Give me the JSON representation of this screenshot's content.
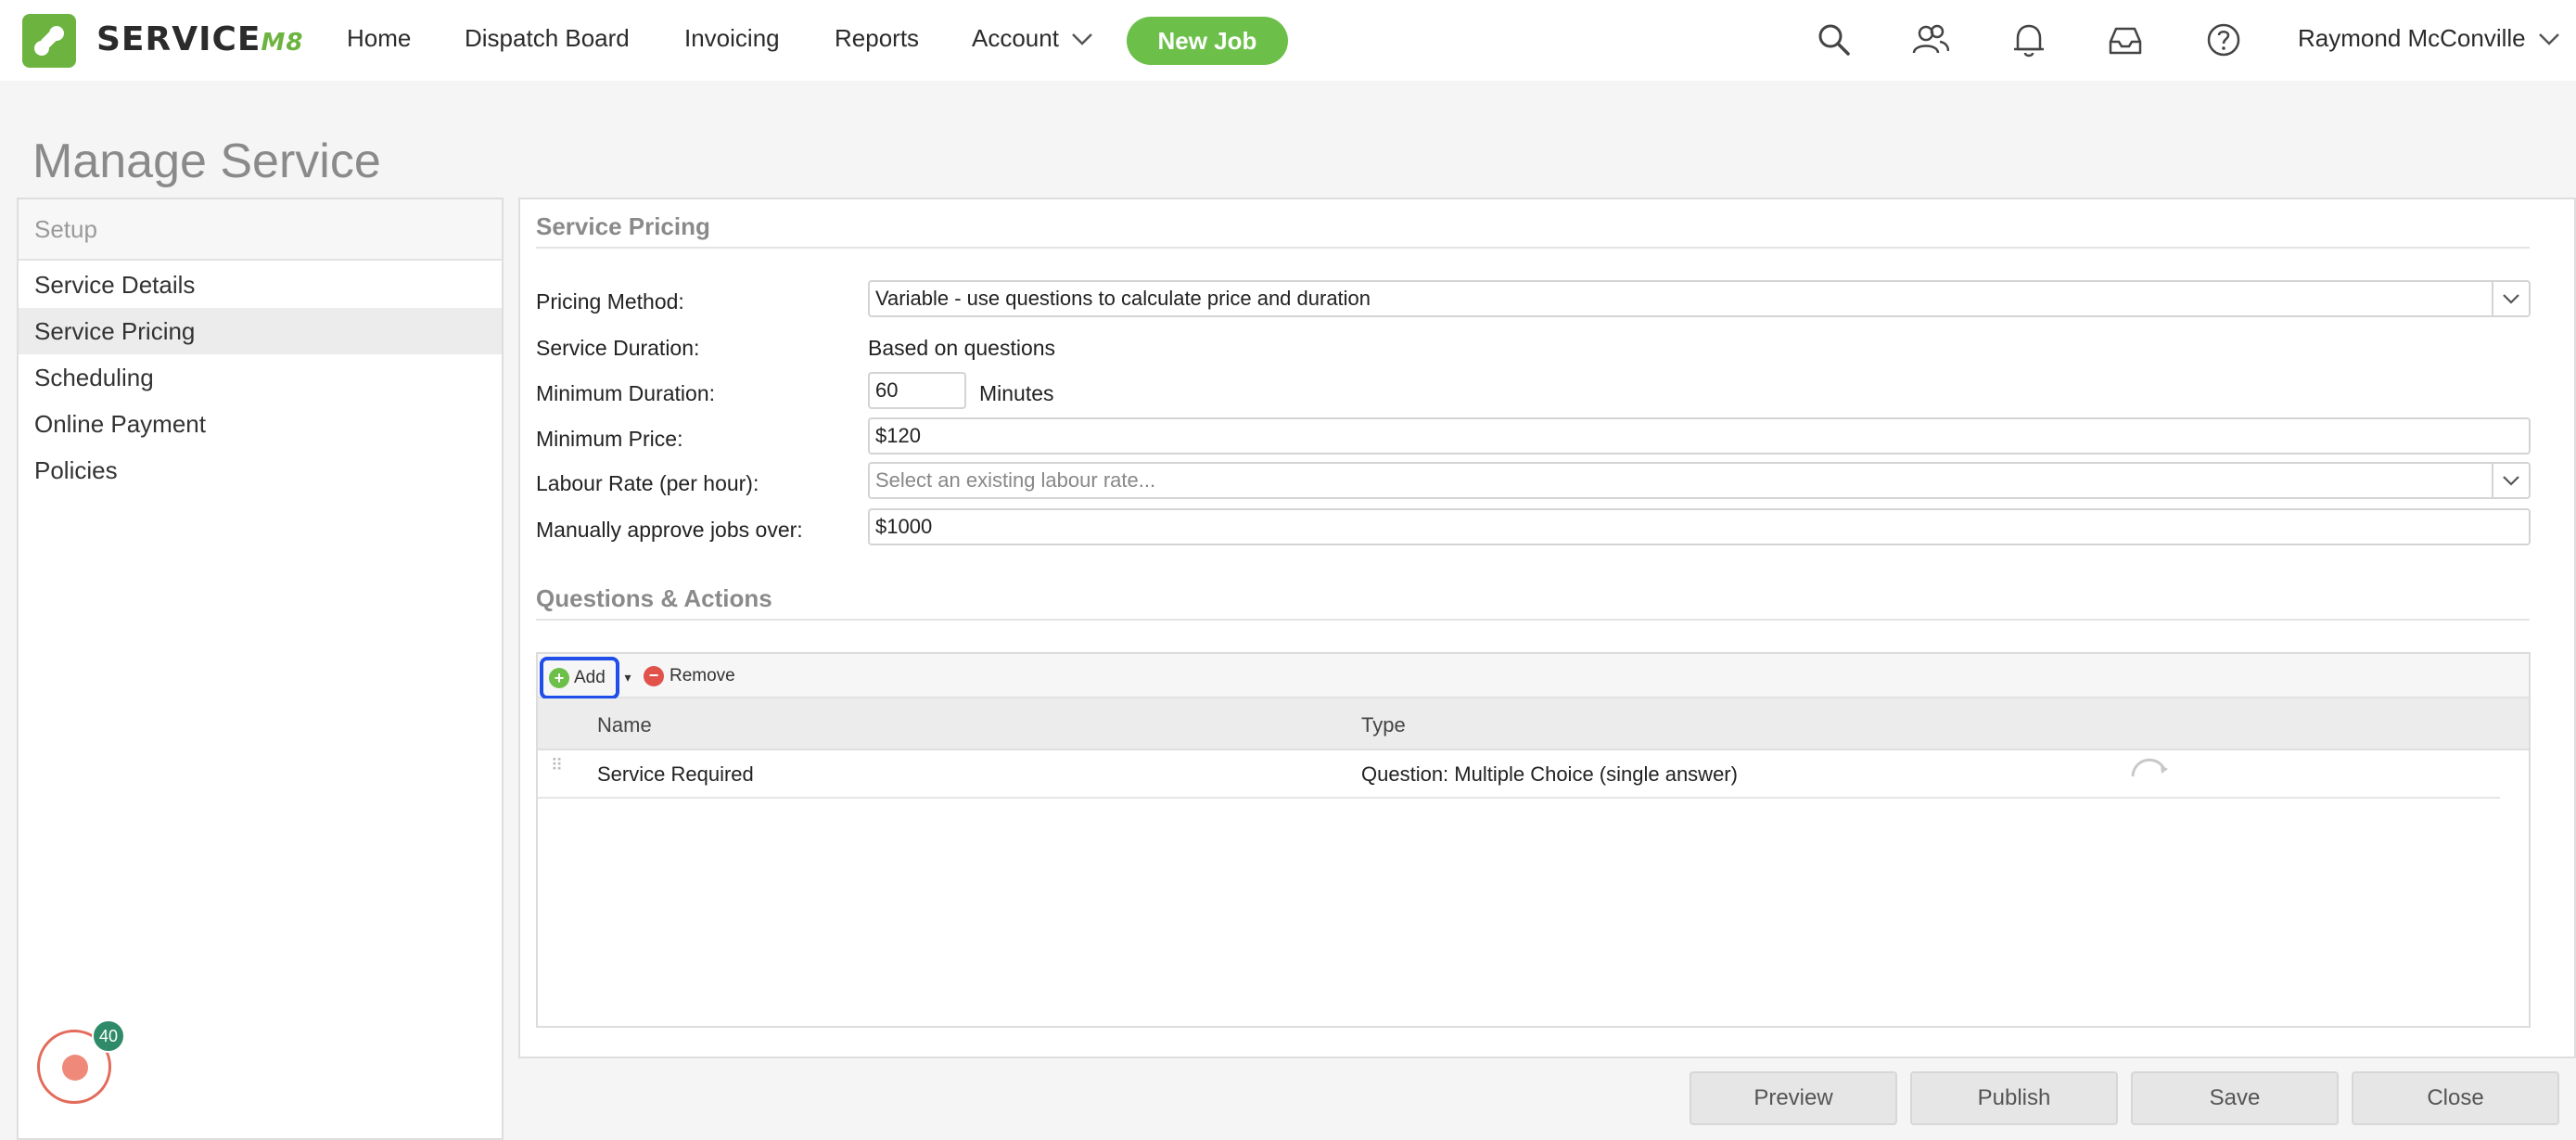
{
  "nav": {
    "brand": "SERVICE",
    "brand_suffix": "M8",
    "items": [
      "Home",
      "Dispatch Board",
      "Invoicing",
      "Reports",
      "Account"
    ],
    "new_job": "New Job",
    "user": "Raymond McConville",
    "icons": [
      "search-icon",
      "people-icon",
      "bell-icon",
      "inbox-icon",
      "help-icon"
    ]
  },
  "page": {
    "title": "Manage Service"
  },
  "sidebar": {
    "header": "Setup",
    "items": [
      {
        "label": "Service Details"
      },
      {
        "label": "Service Pricing",
        "active": true
      },
      {
        "label": "Scheduling"
      },
      {
        "label": "Online Payment"
      },
      {
        "label": "Policies"
      }
    ],
    "badge_count": "40"
  },
  "pricing": {
    "section_title": "Service Pricing",
    "method_label": "Pricing Method:",
    "method_value": "Variable - use questions to calculate price and duration",
    "duration_label": "Service Duration:",
    "duration_value": "Based on questions",
    "min_duration_label": "Minimum Duration:",
    "min_duration_value": "60",
    "min_duration_unit": "Minutes",
    "min_price_label": "Minimum Price:",
    "min_price_value": "$120",
    "labour_label": "Labour Rate (per hour):",
    "labour_placeholder": "Select an existing labour rate...",
    "approve_label": "Manually approve jobs over:",
    "approve_value": "$1000"
  },
  "questions": {
    "section_title": "Questions & Actions",
    "add_label": "Add",
    "remove_label": "Remove",
    "columns": {
      "name": "Name",
      "type": "Type"
    },
    "rows": [
      {
        "name": "Service Required",
        "type": "Question: Multiple Choice (single answer)"
      }
    ]
  },
  "footer": {
    "preview": "Preview",
    "publish": "Publish",
    "save": "Save",
    "close": "Close"
  },
  "colors": {
    "brand_green": "#6cc04a",
    "focus_blue": "#1f4ee8",
    "remove_red": "#e0524a"
  }
}
